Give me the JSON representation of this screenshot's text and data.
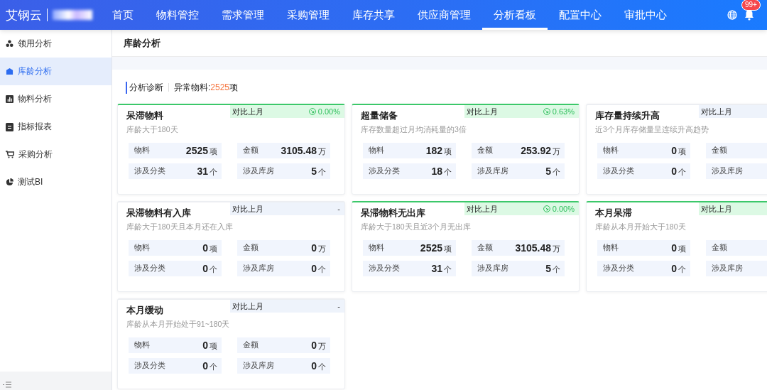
{
  "brand": {
    "name": "艾钢云"
  },
  "nav": [
    {
      "label": "首页",
      "selected": false
    },
    {
      "label": "物料管控",
      "selected": false
    },
    {
      "label": "需求管理",
      "selected": false
    },
    {
      "label": "采购管理",
      "selected": false
    },
    {
      "label": "库存共享",
      "selected": false
    },
    {
      "label": "供应商管理",
      "selected": false
    },
    {
      "label": "分析看板",
      "selected": true
    },
    {
      "label": "配置中心",
      "selected": false
    },
    {
      "label": "审批中心",
      "selected": false
    }
  ],
  "notifications": {
    "badge": "99+"
  },
  "sidebar": {
    "items": [
      {
        "label": "领用分析",
        "selected": false
      },
      {
        "label": "库龄分析",
        "selected": true
      },
      {
        "label": "物料分析",
        "selected": false
      },
      {
        "label": "指标报表",
        "selected": false
      },
      {
        "label": "采购分析",
        "selected": false
      },
      {
        "label": "测试BI",
        "selected": false
      }
    ]
  },
  "page": {
    "title": "库龄分析"
  },
  "summary": {
    "heading": "分析诊断",
    "label": "异常物料:",
    "count": "2525",
    "unit": "项"
  },
  "cards": [
    {
      "title": "呆滞物料",
      "description": "库龄大于180天",
      "compare": {
        "label": "对比上月",
        "value": "0.00%",
        "highlighted": true
      },
      "stats": [
        {
          "label": "物料",
          "value": "2525",
          "unit": "项"
        },
        {
          "label": "金额",
          "value": "3105.48",
          "unit": "万"
        },
        {
          "label": "涉及分类",
          "value": "31",
          "unit": "个"
        },
        {
          "label": "涉及库房",
          "value": "5",
          "unit": "个"
        }
      ]
    },
    {
      "title": "超量储备",
      "description": "库存数量超过月均消耗量的3倍",
      "compare": {
        "label": "对比上月",
        "value": "0.63%",
        "highlighted": true
      },
      "stats": [
        {
          "label": "物料",
          "value": "182",
          "unit": "项"
        },
        {
          "label": "金额",
          "value": "253.92",
          "unit": "万"
        },
        {
          "label": "涉及分类",
          "value": "18",
          "unit": "个"
        },
        {
          "label": "涉及库房",
          "value": "5",
          "unit": "个"
        }
      ]
    },
    {
      "title": "库存量持续升高",
      "description": "近3个月库存储量呈连续升高趋势",
      "compare": {
        "label": "对比上月",
        "highlighted": false
      },
      "stats": [
        {
          "label": "物料",
          "value": "0",
          "unit": "项"
        },
        {
          "label": "金额"
        },
        {
          "label": "涉及分类",
          "value": "0",
          "unit": "个"
        },
        {
          "label": "涉及库房"
        }
      ]
    },
    {
      "title": "呆滞物料有入库",
      "description": "库龄大于180天且本月还在入库",
      "compare": {
        "label": "对比上月",
        "value": "-",
        "highlighted": false
      },
      "stats": [
        {
          "label": "物料",
          "value": "0",
          "unit": "项"
        },
        {
          "label": "金额",
          "value": "0",
          "unit": "万"
        },
        {
          "label": "涉及分类",
          "value": "0",
          "unit": "个"
        },
        {
          "label": "涉及库房",
          "value": "0",
          "unit": "个"
        }
      ]
    },
    {
      "title": "呆滞物料无出库",
      "description": "库龄大于180天且近3个月无出库",
      "compare": {
        "label": "对比上月",
        "value": "0.00%",
        "highlighted": true
      },
      "stats": [
        {
          "label": "物料",
          "value": "2525",
          "unit": "项"
        },
        {
          "label": "金额",
          "value": "3105.48",
          "unit": "万"
        },
        {
          "label": "涉及分类",
          "value": "31",
          "unit": "个"
        },
        {
          "label": "涉及库房",
          "value": "5",
          "unit": "个"
        }
      ]
    },
    {
      "title": "本月呆滞",
      "description": "库龄从本月开始大于180天",
      "compare": {
        "label": "对比上月",
        "highlighted": true
      },
      "stats": [
        {
          "label": "物料",
          "value": "0",
          "unit": "项"
        },
        {
          "label": "金额"
        },
        {
          "label": "涉及分类",
          "value": "0",
          "unit": "个"
        },
        {
          "label": "涉及库房"
        }
      ]
    },
    {
      "title": "本月缓动",
      "description": "库龄从本月开始处于91~180天",
      "compare": {
        "label": "对比上月",
        "value": "-",
        "highlighted": false
      },
      "stats": [
        {
          "label": "物料",
          "value": "0",
          "unit": "项"
        },
        {
          "label": "金额",
          "value": "0",
          "unit": "万"
        },
        {
          "label": "涉及分类",
          "value": "0",
          "unit": "个"
        },
        {
          "label": "涉及库房",
          "value": "0",
          "unit": "个"
        }
      ]
    }
  ]
}
